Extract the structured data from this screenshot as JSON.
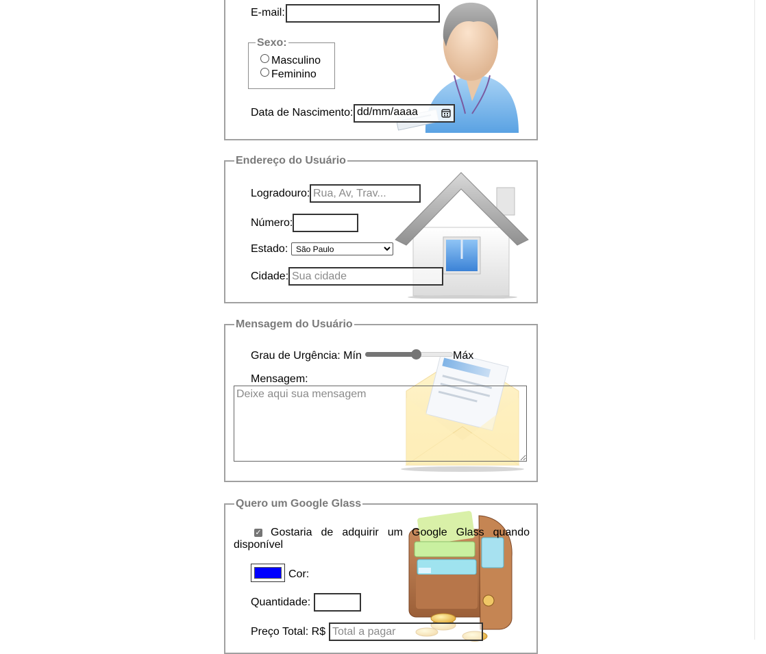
{
  "user_section": {
    "email_label": "E-mail:",
    "email_value": "",
    "sex": {
      "legend": "Sexo:",
      "options": [
        "Masculino",
        "Feminino"
      ],
      "selected": null
    },
    "birth_label": "Data de Nascimento:",
    "birth_placeholder": "dd/mm/aaaa"
  },
  "address_section": {
    "legend": "Endereço do Usuário",
    "street_label": "Logradouro:",
    "street_placeholder": "Rua, Av, Trav...",
    "number_label": "Número:",
    "number_value": "",
    "state_label": "Estado:",
    "state_selected": "São Paulo",
    "city_label": "Cidade:",
    "city_placeholder": "Sua cidade"
  },
  "message_section": {
    "legend": "Mensagem do Usuário",
    "urgency_label": "Grau de Urgência: Mín",
    "urgency_max_label": "Máx",
    "urgency_level": 0.59,
    "message_label": "Mensagem:",
    "message_placeholder": "Deixe aqui sua mensagem"
  },
  "glass_section": {
    "legend": "Quero um Google Glass",
    "checkbox_checked": true,
    "checkbox_text": "Gostaria de adquirir um Google Glass quando disponível",
    "color_value": "#0000ff",
    "color_label": "Cor:",
    "quantity_label": "Quantidade:",
    "quantity_value": "",
    "price_label": "Preço Total: R$",
    "price_placeholder": "Total a pagar"
  },
  "icons": {
    "user": "user-avatar-icon",
    "house": "house-icon",
    "envelope": "envelope-icon",
    "wallet": "wallet-icon",
    "calendar": "calendar-icon"
  },
  "colors": {
    "legend_text": "#7a7a7a",
    "border": "#a0a0a0",
    "slider": "#757575"
  }
}
